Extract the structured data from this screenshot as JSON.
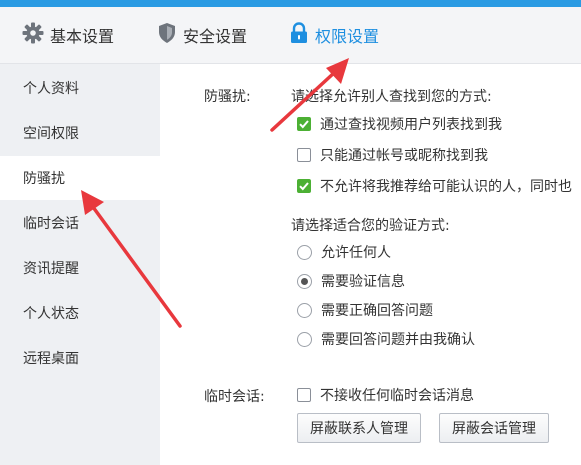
{
  "tabs": [
    {
      "label": "基本设置",
      "icon": "gear-icon"
    },
    {
      "label": "安全设置",
      "icon": "shield-icon"
    },
    {
      "label": "权限设置",
      "icon": "lock-icon",
      "active": true
    }
  ],
  "sidebar": {
    "items": [
      {
        "label": "个人资料"
      },
      {
        "label": "空间权限"
      },
      {
        "label": "防骚扰",
        "active": true
      },
      {
        "label": "临时会话"
      },
      {
        "label": "资讯提醒"
      },
      {
        "label": "个人状态"
      },
      {
        "label": "远程桌面"
      }
    ]
  },
  "anti_harass": {
    "section_label": "防骚扰:",
    "find_prompt": "请选择允许别人查找到您的方式:",
    "find_options": [
      {
        "label": "通过查找视频用户列表找到我",
        "checked": true
      },
      {
        "label": "只能通过帐号或昵称找到我",
        "checked": false
      },
      {
        "label": "不允许将我推荐给可能认识的人，同时也",
        "checked": true
      }
    ],
    "verify_prompt": "请选择适合您的验证方式:",
    "verify_options": [
      {
        "label": "允许任何人",
        "selected": false
      },
      {
        "label": "需要验证信息",
        "selected": true
      },
      {
        "label": "需要正确回答问题",
        "selected": false
      },
      {
        "label": "需要回答问题并由我确认",
        "selected": false
      }
    ]
  },
  "temp_session": {
    "section_label": "临时会话:",
    "option": {
      "label": "不接收任何临时会话消息",
      "checked": false
    },
    "buttons": [
      "屏蔽联系人管理",
      "屏蔽会话管理"
    ]
  },
  "colors": {
    "accent": "#1e8fe0",
    "check_green": "#4cb034",
    "annotation_arrow": "#e8383d"
  }
}
